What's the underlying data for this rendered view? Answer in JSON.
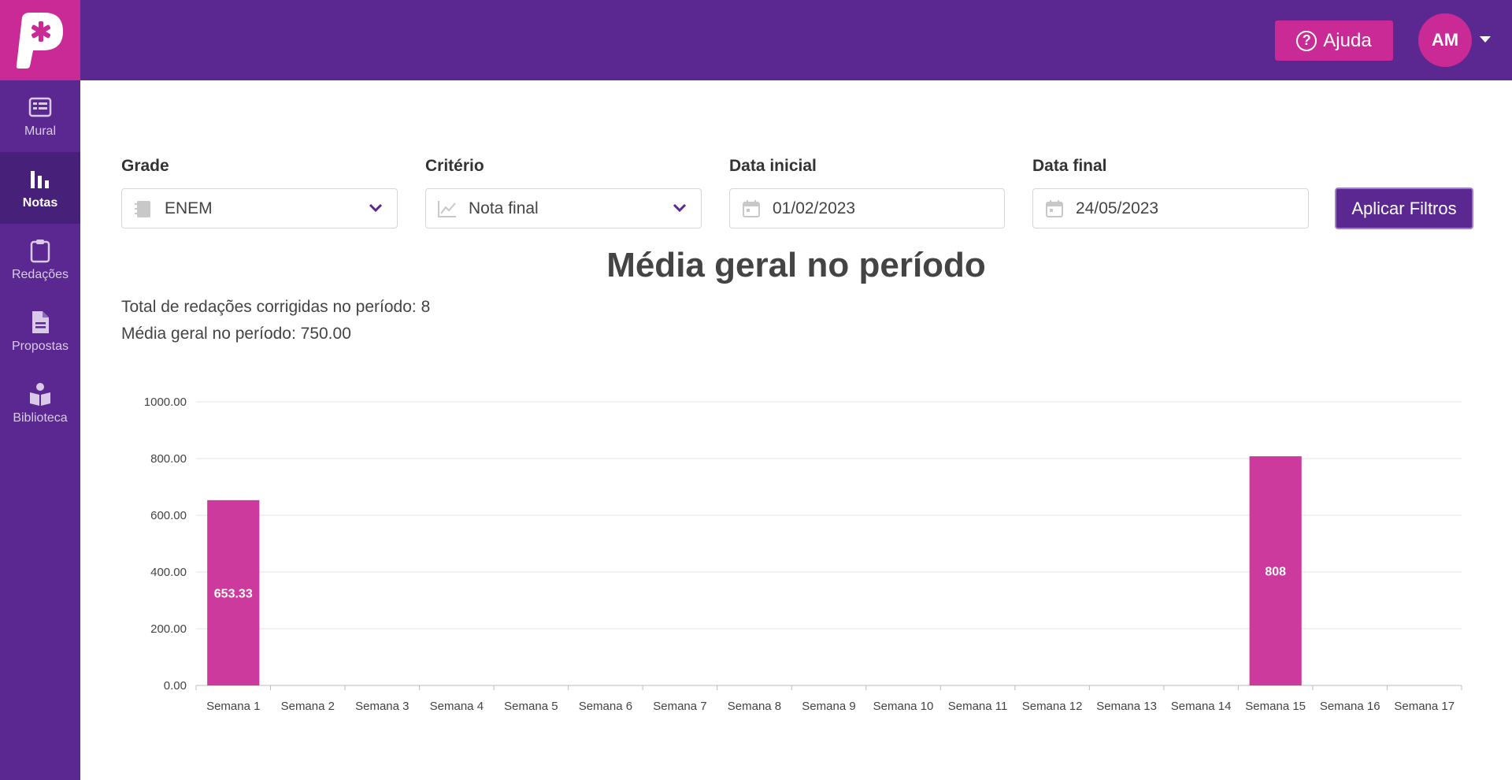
{
  "header": {
    "help_label": "Ajuda",
    "avatar_initials": "AM"
  },
  "sidebar": {
    "items": [
      {
        "label": "Mural",
        "icon": "mural-icon",
        "active": false
      },
      {
        "label": "Notas",
        "icon": "bar-chart-icon",
        "active": true
      },
      {
        "label": "Redações",
        "icon": "clipboard-icon",
        "active": false
      },
      {
        "label": "Propostas",
        "icon": "document-icon",
        "active": false
      },
      {
        "label": "Biblioteca",
        "icon": "book-reader-icon",
        "active": false
      }
    ]
  },
  "filters": {
    "grade": {
      "label": "Grade",
      "value": "ENEM"
    },
    "criterio": {
      "label": "Critério",
      "value": "Nota final"
    },
    "data_inicial": {
      "label": "Data inicial",
      "value": "01/02/2023"
    },
    "data_final": {
      "label": "Data final",
      "value": "24/05/2023"
    },
    "apply_label": "Aplicar Filtros"
  },
  "summary": {
    "title": "Média geral no período",
    "total_line": "Total de redações corrigidas no período: 8",
    "media_line": "Média geral no período: 750.00"
  },
  "colors": {
    "primary": "#5b2891",
    "accent": "#c92a95",
    "bar": "#cc3a9e"
  },
  "chart_data": {
    "type": "bar",
    "categories": [
      "Semana 1",
      "Semana 2",
      "Semana 3",
      "Semana 4",
      "Semana 5",
      "Semana 6",
      "Semana 7",
      "Semana 8",
      "Semana 9",
      "Semana 10",
      "Semana 11",
      "Semana 12",
      "Semana 13",
      "Semana 14",
      "Semana 15",
      "Semana 16",
      "Semana 17"
    ],
    "values": [
      653.33,
      null,
      null,
      null,
      null,
      null,
      null,
      null,
      null,
      null,
      null,
      null,
      null,
      null,
      808,
      null,
      null
    ],
    "data_labels": [
      "653.33",
      "",
      "",
      "",
      "",
      "",
      "",
      "",
      "",
      "",
      "",
      "",
      "",
      "",
      "808",
      "",
      ""
    ],
    "ylim": [
      0,
      1000
    ],
    "yticks": [
      "0.00",
      "200.00",
      "400.00",
      "600.00",
      "800.00",
      "1000.00"
    ],
    "grid": true,
    "legend": "none"
  }
}
